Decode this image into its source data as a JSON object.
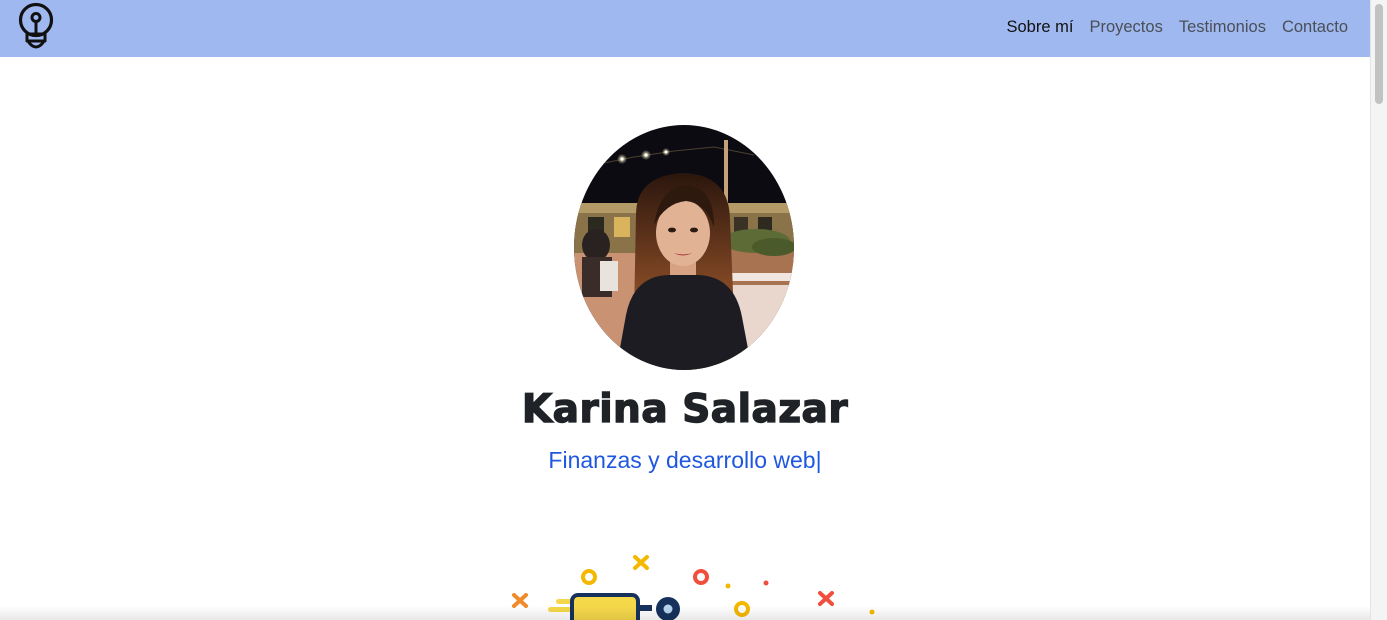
{
  "nav": {
    "items": [
      {
        "label": "Sobre mí",
        "active": true
      },
      {
        "label": "Proyectos",
        "active": false
      },
      {
        "label": "Testimonios",
        "active": false
      },
      {
        "label": "Contacto",
        "active": false
      }
    ]
  },
  "hero": {
    "name": "Karina Salazar",
    "tagline": "Finanzas y desarrollo web",
    "cursor": "|"
  },
  "icons": {
    "logo": "lightbulb-icon"
  },
  "colors": {
    "navbar_bg": "#9fb8ef",
    "tagline": "#1f57e0",
    "name": "#1f2226",
    "accent_yellow": "#f5b800",
    "accent_orange": "#f08a2a",
    "accent_red": "#ef4f3c",
    "accent_navy": "#16325c"
  }
}
